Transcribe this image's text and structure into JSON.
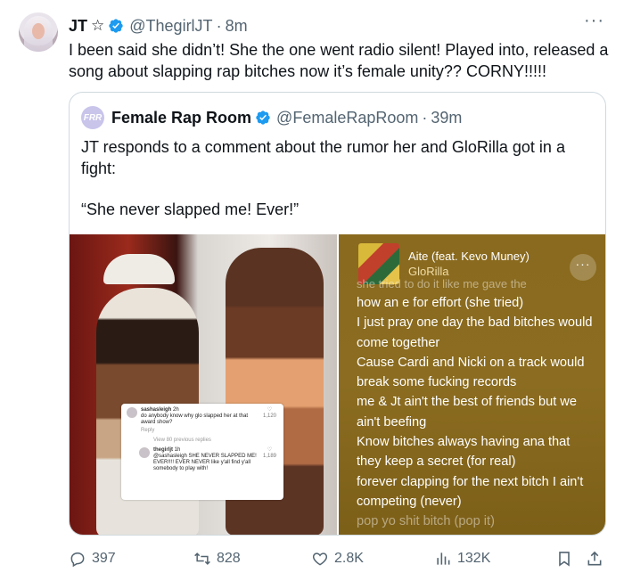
{
  "tweet": {
    "author_name": "JT",
    "author_badge": "☆",
    "handle": "@ThegirlJT",
    "separator": "·",
    "time": "8m",
    "more": "···",
    "text": "I been said she didn’t! She the one went radio silent! Played into, released a song about slapping rap bitches now it’s female unity?? CORNY!!!!!"
  },
  "quote": {
    "logo_text": "FRR",
    "author_name": "Female Rap Room",
    "handle": "@FemaleRapRoom",
    "separator": "·",
    "time": "39m",
    "text": "JT responds to a comment about the rumor her and GloRilla got in a fight:",
    "quoted_line": "“She never slapped me! Ever!”"
  },
  "comments": [
    {
      "user": "sashasleigh",
      "age": "2h",
      "text": "do anybody know why glo slapped her at that award show?",
      "action": "Reply",
      "likes": "1,120"
    },
    {
      "user": "thegirljt",
      "age": "1h",
      "text": "@sashasleigh SHE NEVER SLAPPED ME! EVER!!!! EVER NEVER like y'all find y'all somebody to play with!",
      "likes": "1,189"
    }
  ],
  "view_replies": "View 80 previous replies",
  "lyrics": {
    "song_title": "Aite (feat. Kevo Muney)",
    "artist": "GloRilla",
    "menu": "···",
    "lines": [
      "she tried to do it like me gave the",
      "how an e for effort (she tried)",
      "I just pray one day the bad bitches would come together",
      "Cause Cardi and Nicki on a track would break some fucking records",
      "me & Jt ain't the best of friends but we ain't beefing",
      "Know bitches always having ana that they keep a secret (for real)",
      "forever clapping for the next bitch I ain't competing (never)",
      "pop yo shit bitch (pop it)"
    ]
  },
  "actions": {
    "replies": "397",
    "reposts": "828",
    "likes": "2.8K",
    "views": "132K"
  },
  "colors": {
    "accent": "#1d9bf0",
    "muted": "#536471",
    "border": "#cfd9de",
    "lyrics_bg": "#8a6a1e"
  }
}
